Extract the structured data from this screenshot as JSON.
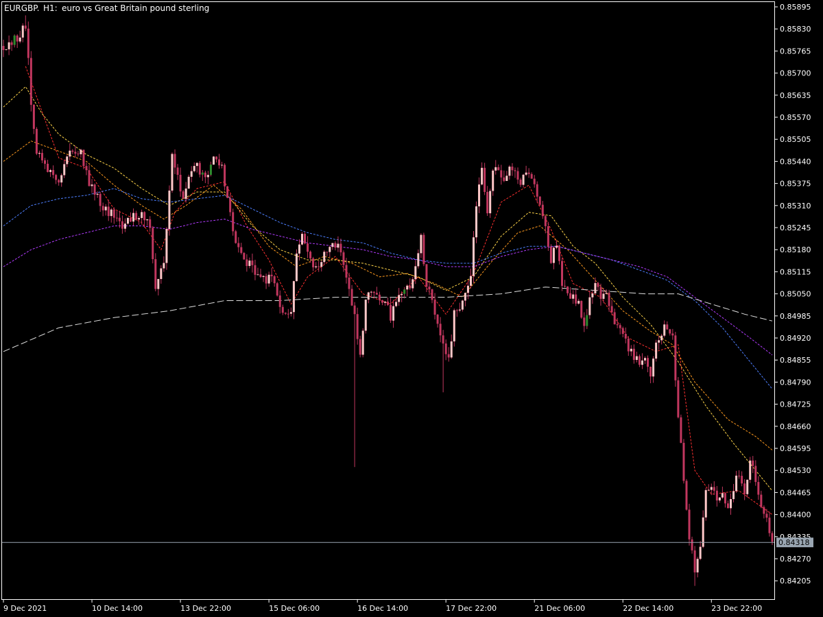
{
  "header": {
    "symbol": "EURGBP.",
    "timeframe": "H1:",
    "description": "euro vs Great Britain pound sterling"
  },
  "current_price": "0.84318",
  "colors": {
    "background": "#000000",
    "frame": "#ffffff",
    "candle": "#c2375f",
    "candle_light": "#ffc8c8",
    "candle_green": "#2e8b2e",
    "price_line": "#9aa6b2",
    "price_tag": "#9aa6b2",
    "ma_red": "#ff3030",
    "ma_orange": "#ff9a1f",
    "ma_yellow": "#ffd54a",
    "ma_blue": "#4d7fff",
    "ma_purple": "#b23bff",
    "ma_white": "#e0e0e0"
  },
  "chart_data": {
    "type": "candlestick",
    "symbol": "EURGBP.",
    "timeframe": "H1",
    "y_ticks": [
      "0.85895",
      "0.85830",
      "0.85765",
      "0.85700",
      "0.85635",
      "0.85570",
      "0.85505",
      "0.85440",
      "0.85375",
      "0.85310",
      "0.85245",
      "0.85180",
      "0.85115",
      "0.85050",
      "0.84985",
      "0.84920",
      "0.84855",
      "0.84790",
      "0.84725",
      "0.84660",
      "0.84595",
      "0.84530",
      "0.84465",
      "0.84400",
      "0.84335",
      "0.84270",
      "0.84205"
    ],
    "ylim": [
      0.8416,
      0.85903
    ],
    "x_ticks": [
      "9 Dec 2021",
      "10 Dec 14:00",
      "13 Dec 22:00",
      "15 Dec 06:00",
      "16 Dec 14:00",
      "17 Dec 22:00",
      "21 Dec 06:00",
      "22 Dec 14:00",
      "23 Dec 22:00"
    ],
    "x_tick_bar_index": [
      0,
      32,
      64,
      96,
      128,
      160,
      192,
      224,
      256
    ],
    "candles_per_bar_count": 279,
    "close_path": [
      [
        0,
        0.8578
      ],
      [
        5,
        0.858
      ],
      [
        8,
        0.8584
      ],
      [
        10,
        0.8562
      ],
      [
        12,
        0.8546
      ],
      [
        16,
        0.8542
      ],
      [
        20,
        0.8539
      ],
      [
        24,
        0.8546
      ],
      [
        28,
        0.8547
      ],
      [
        31,
        0.8538
      ],
      [
        34,
        0.8533
      ],
      [
        37,
        0.853
      ],
      [
        40,
        0.8528
      ],
      [
        43,
        0.8525
      ],
      [
        46,
        0.8527
      ],
      [
        50,
        0.8529
      ],
      [
        53,
        0.8524
      ],
      [
        55,
        0.8506
      ],
      [
        58,
        0.8514
      ],
      [
        61,
        0.8546
      ],
      [
        63,
        0.8541
      ],
      [
        65,
        0.8532
      ],
      [
        67,
        0.854
      ],
      [
        70,
        0.8543
      ],
      [
        73,
        0.8538
      ],
      [
        76,
        0.8545
      ],
      [
        79,
        0.8542
      ],
      [
        82,
        0.8528
      ],
      [
        85,
        0.8518
      ],
      [
        88,
        0.8514
      ],
      [
        91,
        0.8512
      ],
      [
        94,
        0.8509
      ],
      [
        97,
        0.851
      ],
      [
        99,
        0.8504
      ],
      [
        101,
        0.8498
      ],
      [
        104,
        0.85
      ],
      [
        106,
        0.8518
      ],
      [
        108,
        0.8522
      ],
      [
        110,
        0.8518
      ],
      [
        112,
        0.8513
      ],
      [
        115,
        0.8515
      ],
      [
        118,
        0.8518
      ],
      [
        121,
        0.852
      ],
      [
        123,
        0.8513
      ],
      [
        125,
        0.8506
      ],
      [
        127,
        0.8498
      ],
      [
        129,
        0.8486
      ],
      [
        131,
        0.8504
      ],
      [
        133,
        0.8506
      ],
      [
        135,
        0.8505
      ],
      [
        138,
        0.8503
      ],
      [
        140,
        0.8498
      ],
      [
        142,
        0.8502
      ],
      [
        144,
        0.8506
      ],
      [
        147,
        0.8507
      ],
      [
        149,
        0.8514
      ],
      [
        151,
        0.8521
      ],
      [
        153,
        0.8508
      ],
      [
        155,
        0.8502
      ],
      [
        157,
        0.8497
      ],
      [
        159,
        0.849
      ],
      [
        161,
        0.8485
      ],
      [
        163,
        0.8499
      ],
      [
        165,
        0.8501
      ],
      [
        167,
        0.8504
      ],
      [
        169,
        0.851
      ],
      [
        171,
        0.8532
      ],
      [
        173,
        0.8541
      ],
      [
        175,
        0.853
      ],
      [
        177,
        0.8542
      ],
      [
        179,
        0.854
      ],
      [
        181,
        0.8538
      ],
      [
        183,
        0.8541
      ],
      [
        185,
        0.854
      ],
      [
        187,
        0.8538
      ],
      [
        189,
        0.8542
      ],
      [
        191,
        0.854
      ],
      [
        193,
        0.8535
      ],
      [
        196,
        0.8525
      ],
      [
        198,
        0.8515
      ],
      [
        200,
        0.852
      ],
      [
        202,
        0.8508
      ],
      [
        204,
        0.8505
      ],
      [
        206,
        0.8504
      ],
      [
        208,
        0.8502
      ],
      [
        210,
        0.8495
      ],
      [
        212,
        0.8505
      ],
      [
        214,
        0.8507
      ],
      [
        216,
        0.8505
      ],
      [
        218,
        0.8504
      ],
      [
        220,
        0.8499
      ],
      [
        222,
        0.8496
      ],
      [
        224,
        0.8492
      ],
      [
        226,
        0.8489
      ],
      [
        228,
        0.8487
      ],
      [
        230,
        0.8485
      ],
      [
        232,
        0.8486
      ],
      [
        234,
        0.848
      ],
      [
        236,
        0.849
      ],
      [
        238,
        0.8494
      ],
      [
        240,
        0.8495
      ],
      [
        242,
        0.8492
      ],
      [
        244,
        0.847
      ],
      [
        246,
        0.845
      ],
      [
        248,
        0.8433
      ],
      [
        250,
        0.8423
      ],
      [
        252,
        0.8432
      ],
      [
        254,
        0.8448
      ],
      [
        256,
        0.8447
      ],
      [
        258,
        0.8445
      ],
      [
        260,
        0.8446
      ],
      [
        262,
        0.8442
      ],
      [
        264,
        0.8448
      ],
      [
        266,
        0.8452
      ],
      [
        268,
        0.8447
      ],
      [
        270,
        0.8455
      ],
      [
        272,
        0.8451
      ],
      [
        274,
        0.8443
      ],
      [
        276,
        0.8438
      ],
      [
        278,
        0.84318
      ]
    ],
    "moving_averages": [
      {
        "color": "ma_red",
        "style": "dashed",
        "points": [
          [
            8,
            0.8572
          ],
          [
            20,
            0.8545
          ],
          [
            30,
            0.8542
          ],
          [
            40,
            0.853
          ],
          [
            50,
            0.8526
          ],
          [
            57,
            0.8518
          ],
          [
            62,
            0.8529
          ],
          [
            70,
            0.8536
          ],
          [
            80,
            0.8538
          ],
          [
            88,
            0.8525
          ],
          [
            96,
            0.8515
          ],
          [
            104,
            0.8502
          ],
          [
            110,
            0.851
          ],
          [
            120,
            0.8516
          ],
          [
            130,
            0.8505
          ],
          [
            140,
            0.8502
          ],
          [
            150,
            0.851
          ],
          [
            160,
            0.8499
          ],
          [
            170,
            0.8511
          ],
          [
            180,
            0.8532
          ],
          [
            190,
            0.8537
          ],
          [
            198,
            0.8524
          ],
          [
            206,
            0.8508
          ],
          [
            216,
            0.8504
          ],
          [
            226,
            0.8492
          ],
          [
            236,
            0.8488
          ],
          [
            244,
            0.849
          ],
          [
            250,
            0.8453
          ],
          [
            256,
            0.8446
          ],
          [
            266,
            0.8447
          ],
          [
            278,
            0.844
          ]
        ]
      },
      {
        "color": "ma_orange",
        "style": "dashed",
        "points": [
          [
            0,
            0.8544
          ],
          [
            10,
            0.855
          ],
          [
            20,
            0.8547
          ],
          [
            30,
            0.8544
          ],
          [
            40,
            0.8537
          ],
          [
            50,
            0.8531
          ],
          [
            58,
            0.8527
          ],
          [
            66,
            0.8531
          ],
          [
            76,
            0.8537
          ],
          [
            86,
            0.853
          ],
          [
            96,
            0.8519
          ],
          [
            106,
            0.8513
          ],
          [
            116,
            0.8516
          ],
          [
            126,
            0.8514
          ],
          [
            136,
            0.851
          ],
          [
            146,
            0.8511
          ],
          [
            156,
            0.8508
          ],
          [
            166,
            0.8504
          ],
          [
            176,
            0.8514
          ],
          [
            186,
            0.8523
          ],
          [
            194,
            0.8525
          ],
          [
            204,
            0.8518
          ],
          [
            214,
            0.8509
          ],
          [
            224,
            0.85
          ],
          [
            234,
            0.8494
          ],
          [
            242,
            0.849
          ],
          [
            250,
            0.8479
          ],
          [
            262,
            0.8468
          ],
          [
            272,
            0.8463
          ],
          [
            278,
            0.8459
          ]
        ]
      },
      {
        "color": "ma_yellow",
        "style": "dashed",
        "points": [
          [
            0,
            0.856
          ],
          [
            8,
            0.8566
          ],
          [
            14,
            0.8558
          ],
          [
            20,
            0.8552
          ],
          [
            30,
            0.8546
          ],
          [
            40,
            0.8542
          ],
          [
            50,
            0.8536
          ],
          [
            60,
            0.8531
          ],
          [
            70,
            0.8535
          ],
          [
            80,
            0.8535
          ],
          [
            90,
            0.8525
          ],
          [
            100,
            0.8518
          ],
          [
            110,
            0.8515
          ],
          [
            120,
            0.8515
          ],
          [
            130,
            0.8514
          ],
          [
            140,
            0.8512
          ],
          [
            150,
            0.851
          ],
          [
            160,
            0.8506
          ],
          [
            170,
            0.851
          ],
          [
            180,
            0.8522
          ],
          [
            190,
            0.8529
          ],
          [
            198,
            0.8528
          ],
          [
            206,
            0.8519
          ],
          [
            214,
            0.8514
          ],
          [
            224,
            0.8504
          ],
          [
            234,
            0.8496
          ],
          [
            244,
            0.8485
          ],
          [
            254,
            0.8472
          ],
          [
            264,
            0.8461
          ],
          [
            272,
            0.8453
          ],
          [
            278,
            0.8447
          ]
        ]
      },
      {
        "color": "ma_blue",
        "style": "dashed",
        "points": [
          [
            0,
            0.8525
          ],
          [
            10,
            0.8531
          ],
          [
            20,
            0.8533
          ],
          [
            30,
            0.8534
          ],
          [
            40,
            0.8536
          ],
          [
            50,
            0.8533
          ],
          [
            60,
            0.8532
          ],
          [
            70,
            0.8533
          ],
          [
            80,
            0.8534
          ],
          [
            90,
            0.853
          ],
          [
            100,
            0.8526
          ],
          [
            110,
            0.8523
          ],
          [
            120,
            0.8521
          ],
          [
            130,
            0.852
          ],
          [
            140,
            0.8517
          ],
          [
            150,
            0.8515
          ],
          [
            160,
            0.8514
          ],
          [
            170,
            0.8514
          ],
          [
            180,
            0.8517
          ],
          [
            190,
            0.8519
          ],
          [
            200,
            0.8519
          ],
          [
            210,
            0.8517
          ],
          [
            220,
            0.8515
          ],
          [
            230,
            0.8512
          ],
          [
            240,
            0.8509
          ],
          [
            250,
            0.8503
          ],
          [
            260,
            0.8495
          ],
          [
            270,
            0.8485
          ],
          [
            278,
            0.8477
          ]
        ]
      },
      {
        "color": "ma_purple",
        "style": "dashed",
        "points": [
          [
            0,
            0.8513
          ],
          [
            10,
            0.8518
          ],
          [
            20,
            0.8521
          ],
          [
            30,
            0.8523
          ],
          [
            40,
            0.8525
          ],
          [
            50,
            0.8525
          ],
          [
            60,
            0.8524
          ],
          [
            70,
            0.8526
          ],
          [
            80,
            0.8527
          ],
          [
            90,
            0.8524
          ],
          [
            100,
            0.8522
          ],
          [
            110,
            0.852
          ],
          [
            120,
            0.8519
          ],
          [
            130,
            0.8518
          ],
          [
            140,
            0.8516
          ],
          [
            150,
            0.8515
          ],
          [
            160,
            0.8513
          ],
          [
            170,
            0.8513
          ],
          [
            180,
            0.8516
          ],
          [
            190,
            0.8518
          ],
          [
            200,
            0.8519
          ],
          [
            210,
            0.8517
          ],
          [
            220,
            0.8515
          ],
          [
            230,
            0.8513
          ],
          [
            240,
            0.851
          ],
          [
            250,
            0.8504
          ],
          [
            260,
            0.8498
          ],
          [
            270,
            0.8492
          ],
          [
            278,
            0.8487
          ]
        ]
      },
      {
        "color": "ma_white",
        "style": "longdash",
        "points": [
          [
            0,
            0.8488
          ],
          [
            20,
            0.8495
          ],
          [
            40,
            0.8498
          ],
          [
            60,
            0.85
          ],
          [
            80,
            0.8503
          ],
          [
            100,
            0.8503
          ],
          [
            120,
            0.8504
          ],
          [
            140,
            0.8504
          ],
          [
            160,
            0.8504
          ],
          [
            180,
            0.8505
          ],
          [
            196,
            0.8507
          ],
          [
            214,
            0.8506
          ],
          [
            232,
            0.8505
          ],
          [
            244,
            0.8505
          ],
          [
            256,
            0.8502
          ],
          [
            268,
            0.8499
          ],
          [
            278,
            0.8497
          ]
        ]
      }
    ]
  }
}
